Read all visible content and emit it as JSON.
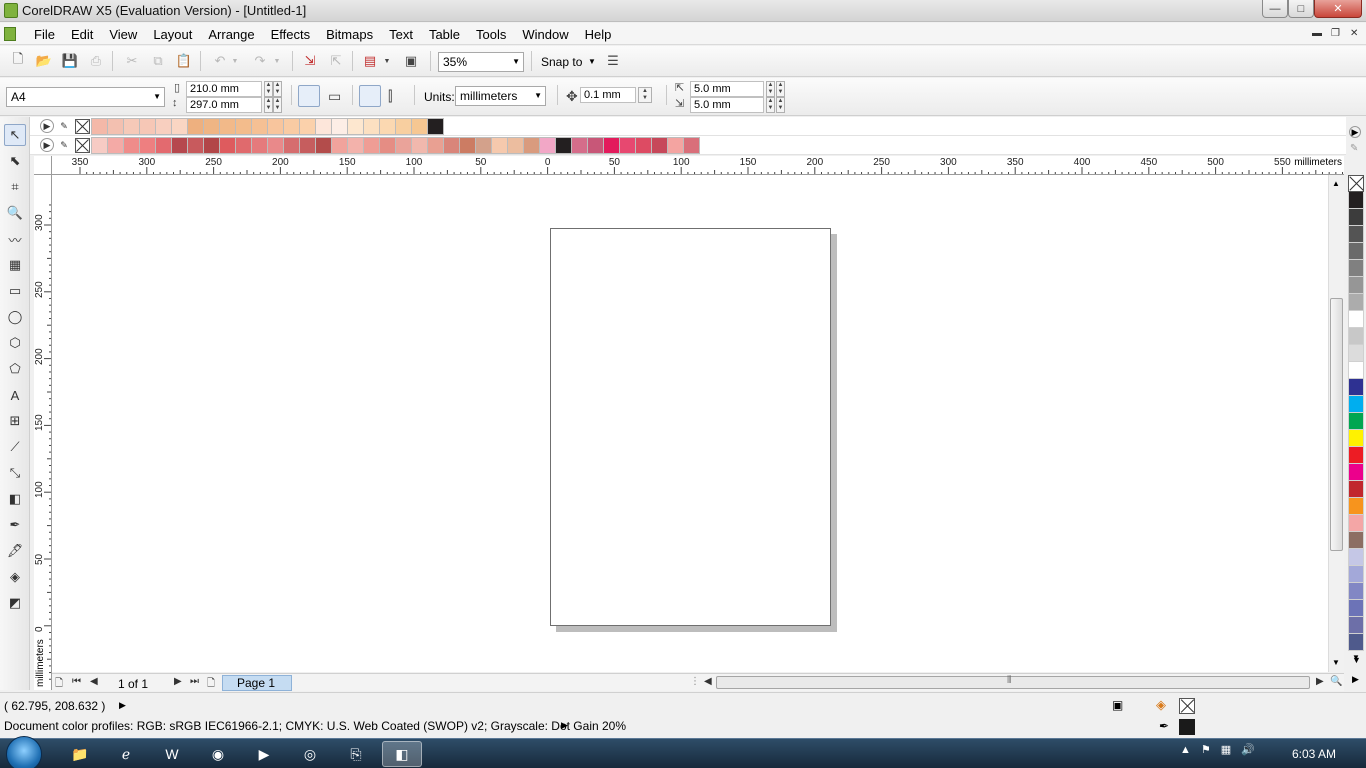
{
  "window": {
    "title": "CorelDRAW X5 (Evaluation Version) - [Untitled-1]",
    "minimize": "—",
    "maximize": "□",
    "close": "✕"
  },
  "menu": {
    "items": [
      "File",
      "Edit",
      "View",
      "Layout",
      "Arrange",
      "Effects",
      "Bitmaps",
      "Text",
      "Table",
      "Tools",
      "Window",
      "Help"
    ]
  },
  "standard_toolbar": {
    "zoom": "35%",
    "snap_to": "Snap to"
  },
  "property_bar": {
    "page_size": "A4",
    "width": "210.0 mm",
    "height": "297.0 mm",
    "units_label": "Units:",
    "units": "millimeters",
    "nudge": "0.1 mm",
    "dup_x": "5.0 mm",
    "dup_y": "5.0 mm"
  },
  "palette_rows": [
    {
      "colors": [
        "#f4b8a8",
        "#f3c0b0",
        "#f6c9b8",
        "#f6c7b6",
        "#f8cfbf",
        "#fad6c3",
        "#eeb07f",
        "#efb584",
        "#f2b989",
        "#f3bc8c",
        "#f5c094",
        "#f8c59d",
        "#f9cba3",
        "#fbd1ab",
        "#fde6da",
        "#fdeee6",
        "#fde7cf",
        "#fce0c1",
        "#fbd8b1",
        "#f8cfa0",
        "#f6c792",
        "#231f20"
      ]
    },
    {
      "colors": [
        "#f7cbc4",
        "#f4aaa6",
        "#ef8c8a",
        "#ee7f80",
        "#e36a6f",
        "#b6484e",
        "#c85a5d",
        "#b24648",
        "#de5b5e",
        "#e06a6d",
        "#e57a7c",
        "#e9898a",
        "#d66d6e",
        "#c65d5e",
        "#b34c4b",
        "#f1a39c",
        "#f3b2ab",
        "#ef9d95",
        "#e58d84",
        "#eaa39a",
        "#f1b8ad",
        "#e9a092",
        "#d9857a",
        "#cc7c63",
        "#d3a18b",
        "#f6c9ad",
        "#ecbd9f",
        "#d99b7e",
        "#f2a7c6",
        "#231f20",
        "#d56d8a",
        "#c85778",
        "#e31b5c",
        "#e74870",
        "#dd4b63",
        "#c7485a",
        "#f4a4a1",
        "#d96f7a"
      ]
    }
  ],
  "ruler_h": {
    "labels": [
      "350",
      "300",
      "250",
      "200",
      "150",
      "100",
      "50",
      "0",
      "50",
      "100",
      "150",
      "200",
      "250",
      "300",
      "350",
      "400",
      "450",
      "500",
      "550"
    ],
    "unit": "millimeters"
  },
  "ruler_v": {
    "labels": [
      "300",
      "250",
      "200",
      "150",
      "100",
      "50",
      "0"
    ],
    "unit": "millimeters"
  },
  "color_palette": [
    "#231f20",
    "#3c3c3c",
    "#545454",
    "#6a6a6a",
    "#808080",
    "#969696",
    "#acacac",
    "#ffffff",
    "#c8c8c8",
    "#dcdcdc",
    "#ffffff",
    "#2e3192",
    "#00aeef",
    "#00a651",
    "#fff200",
    "#ed1c24",
    "#ec008c",
    "#c1272d",
    "#f7941d",
    "#f4a6a6",
    "#8c6e63",
    "#c5c7e6",
    "#a3a8d9",
    "#8287c4",
    "#6c73b7",
    "#6d6fa8",
    "#4f5a8c"
  ],
  "navigator": {
    "page_count": "1 of 1",
    "page_tab": "Page 1"
  },
  "status": {
    "coords": "( 62.795, 208.632 )",
    "profiles": "Document color profiles: RGB: sRGB IEC61966-2.1; CMYK: U.S. Web Coated (SWOP) v2; Grayscale: Dot Gain 20%"
  },
  "taskbar": {
    "clock": "6:03 AM"
  }
}
